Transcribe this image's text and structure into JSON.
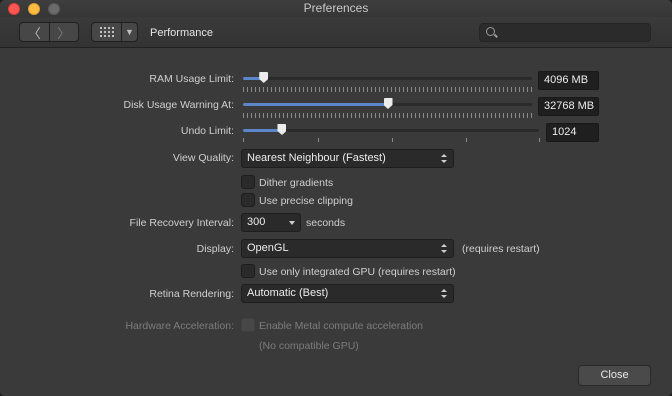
{
  "window": {
    "title": "Preferences"
  },
  "toolbar": {
    "back_glyph": "〈",
    "forward_glyph": "〉",
    "page_title": "Performance",
    "search_placeholder": "",
    "search_value": ""
  },
  "ram": {
    "label": "RAM Usage Limit:",
    "value": "4096 MB",
    "level": 0.07
  },
  "disk": {
    "label": "Disk Usage Warning At:",
    "value": "32768 MB",
    "level": 0.5
  },
  "undo": {
    "label": "Undo Limit:",
    "value": "1024",
    "level": 0.13
  },
  "view_quality": {
    "label": "View Quality:",
    "selected": "Nearest Neighbour (Fastest)"
  },
  "dither": {
    "label": "Dither gradients",
    "checked": false
  },
  "clipping": {
    "label": "Use precise clipping",
    "checked": false
  },
  "recovery": {
    "label": "File Recovery Interval:",
    "selected": "300",
    "unit": "seconds"
  },
  "display": {
    "label": "Display:",
    "selected": "OpenGL",
    "note": "(requires restart)"
  },
  "integrated_gpu": {
    "label": "Use only integrated GPU (requires restart)",
    "checked": false
  },
  "retina": {
    "label": "Retina Rendering:",
    "selected": "Automatic (Best)"
  },
  "hardware": {
    "label": "Hardware Acceleration:",
    "check_label": "Enable Metal compute acceleration",
    "note": "(No compatible GPU)",
    "checked": false,
    "enabled": false
  },
  "close_button": "Close"
}
